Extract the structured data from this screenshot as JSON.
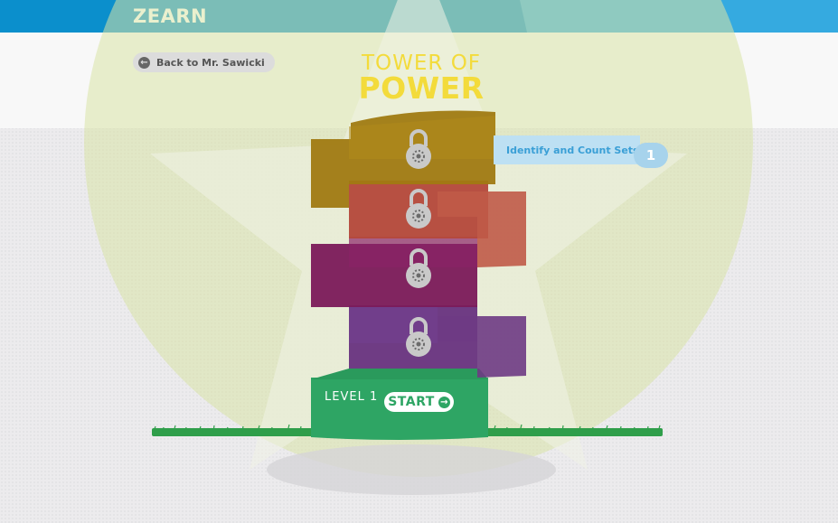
{
  "header": {
    "logo": "ZEARN"
  },
  "nav": {
    "back_label": "Back to Mr. Sawicki"
  },
  "title": {
    "line1": "TOWER OF",
    "line2": "POWER"
  },
  "mission": {
    "name": "Identify and Count Sets",
    "number": "1"
  },
  "level": {
    "label": "LEVEL 1",
    "start_label": "START"
  },
  "icons": {
    "back": "arrow-left-icon",
    "start": "arrow-right-icon",
    "lock": "padlock-icon"
  },
  "colors": {
    "header_blue": "#0b8fcc",
    "title_yellow": "#f3db3b",
    "level_gold": "#a07a12",
    "level_red": "#b4483a",
    "level_magenta": "#7b1a5a",
    "level_purple": "#683380",
    "level_green": "#2ea564"
  }
}
